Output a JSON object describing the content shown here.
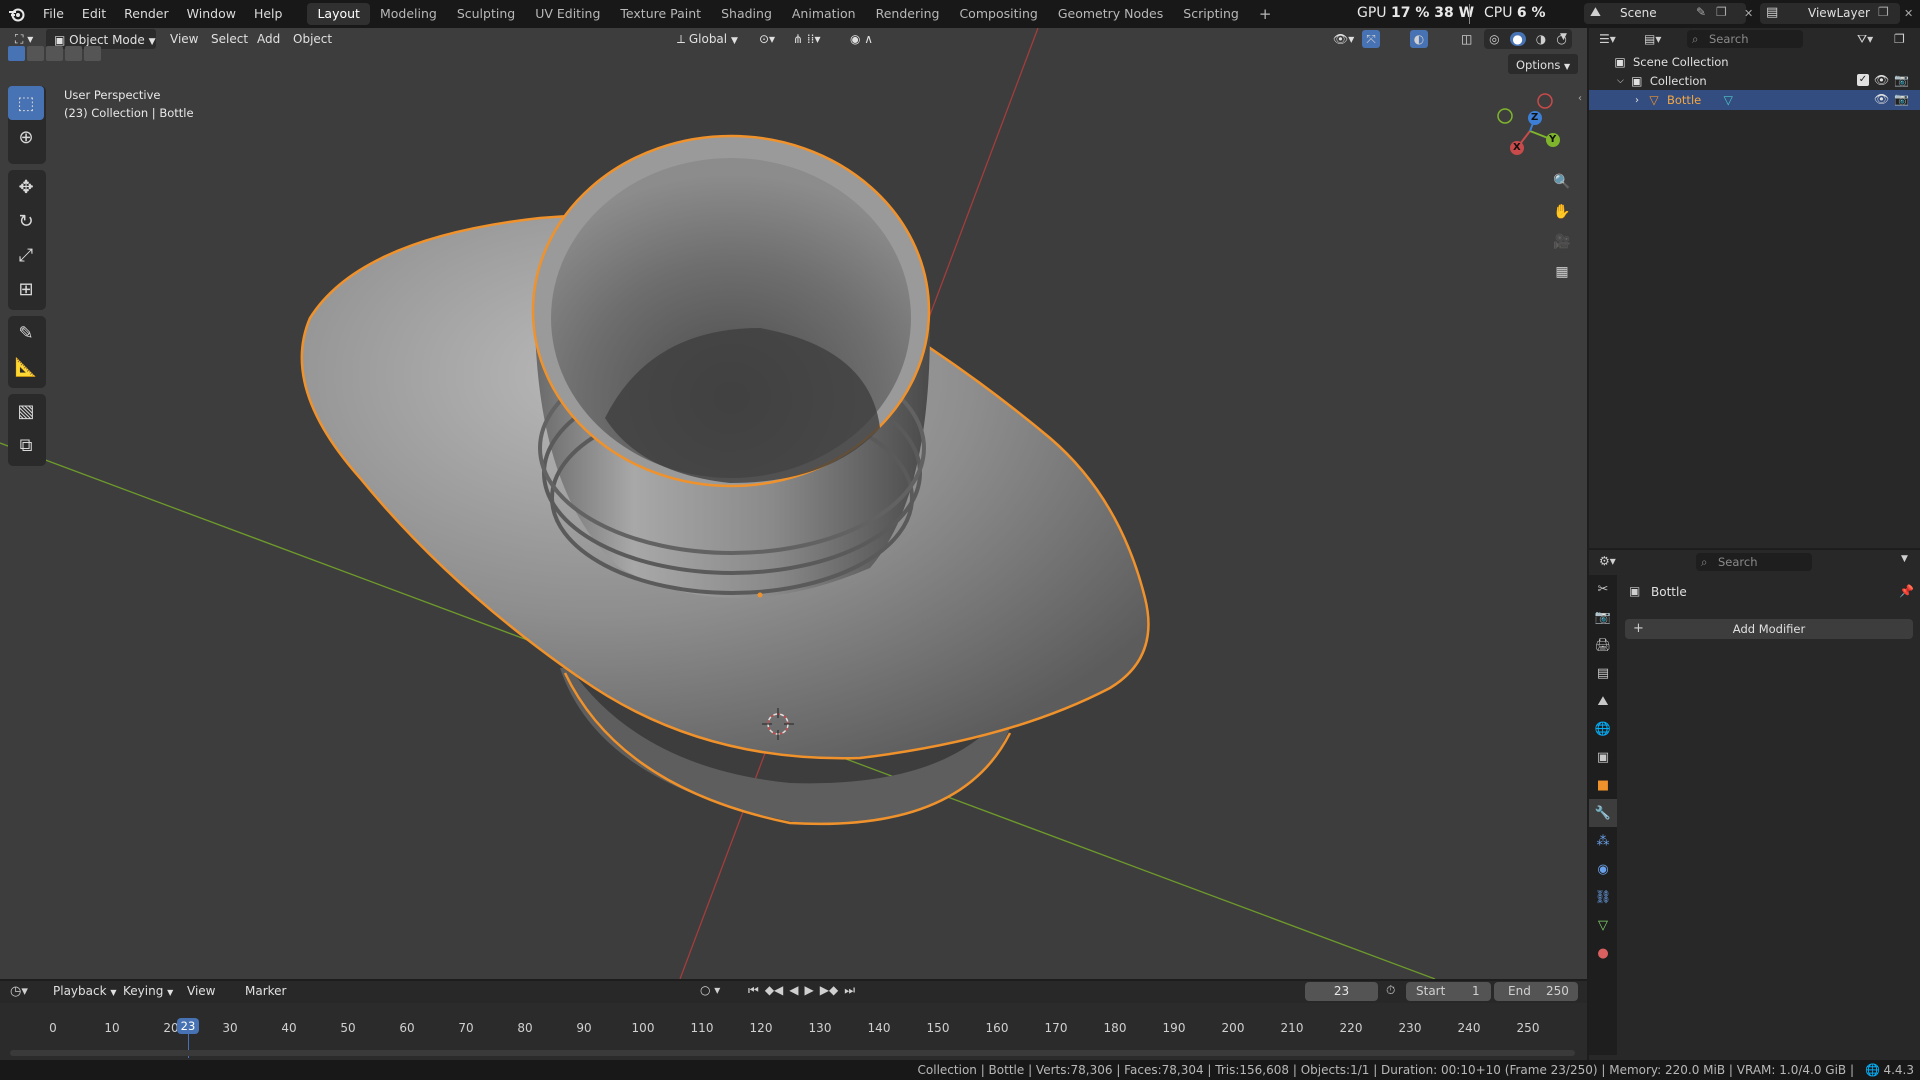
{
  "menu": [
    "File",
    "Edit",
    "Render",
    "Window",
    "Help"
  ],
  "workspaces": [
    "Layout",
    "Modeling",
    "Sculpting",
    "UV Editing",
    "Texture Paint",
    "Shading",
    "Animation",
    "Rendering",
    "Compositing",
    "Geometry Nodes",
    "Scripting"
  ],
  "active_workspace": "Layout",
  "add_workspace": "+",
  "stats": {
    "gpu_label": "GPU",
    "gpu_value": "17 % 38 W",
    "cpu_label": "CPU",
    "cpu_value": "6 %"
  },
  "scene": {
    "name": "Scene",
    "view_layer": "ViewLayer"
  },
  "viewport": {
    "mode": "Object Mode",
    "menus": [
      "View",
      "Select",
      "Add",
      "Object"
    ],
    "orientation": "Global",
    "options_label": "Options",
    "overlay_line1": "User Perspective",
    "overlay_line2": "(23) Collection | Bottle",
    "gizmo": {
      "x": "X",
      "y": "Y",
      "z": "Z"
    }
  },
  "outliner": {
    "search_placeholder": "Search",
    "items": [
      {
        "label": "Scene Collection"
      },
      {
        "label": "Collection"
      },
      {
        "label": "Bottle"
      }
    ]
  },
  "properties": {
    "search_placeholder": "Search",
    "object_name": "Bottle",
    "add_modifier_label": "Add Modifier",
    "add_icon": "+"
  },
  "timeline": {
    "menus": [
      "Playback",
      "Keying",
      "View",
      "Marker"
    ],
    "current_frame": "23",
    "start_label": "Start",
    "start_value": "1",
    "end_label": "End",
    "end_value": "250",
    "ticks": [
      "0",
      "10",
      "20",
      "30",
      "40",
      "50",
      "60",
      "70",
      "80",
      "90",
      "100",
      "110",
      "120",
      "130",
      "140",
      "150",
      "160",
      "170",
      "180",
      "190",
      "200",
      "210",
      "220",
      "230",
      "240",
      "250"
    ],
    "playhead_label": "23"
  },
  "statusbar": {
    "text": "Collection | Bottle | Verts:78,306 | Faces:78,304 | Tris:156,608 | Objects:1/1 | Duration: 00:10+10 (Frame 23/250) | Memory: 220.0 MiB | VRAM: 1.0/4.0 GiB |",
    "version": "4.4.3"
  },
  "colors": {
    "accent": "#4772b3",
    "selection_outline": "#f0922c",
    "x_axis": "#c94a4a",
    "y_axis": "#7fb52d",
    "z_axis": "#3d7fd6"
  }
}
